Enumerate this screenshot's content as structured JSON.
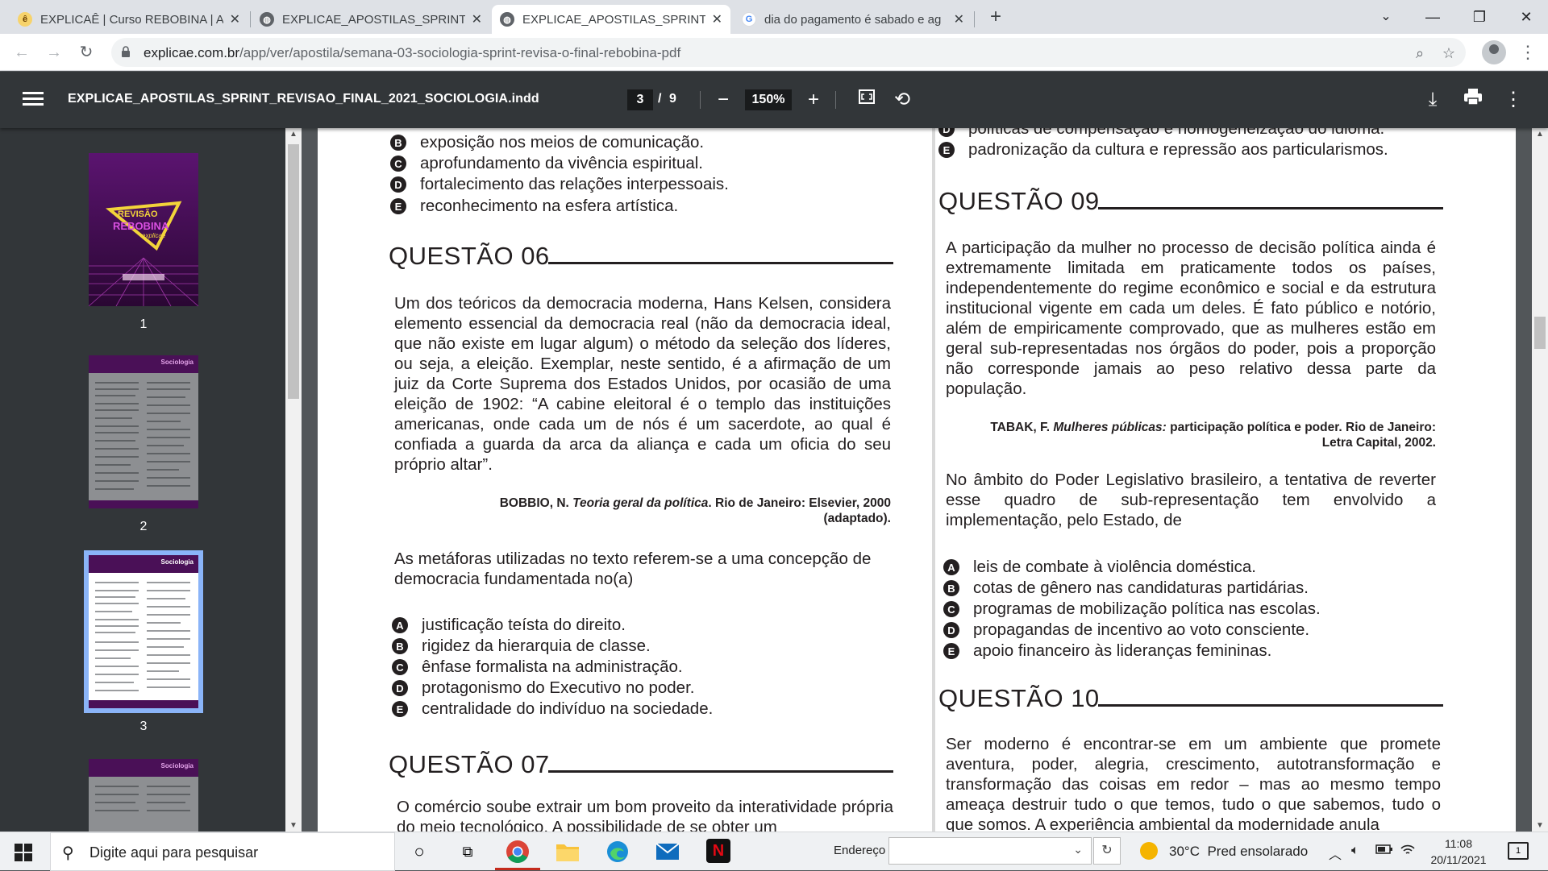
{
  "browser": {
    "tabs": [
      {
        "title": "EXPLICAÊ | Curso REBOBINA | Au",
        "active": false
      },
      {
        "title": "EXPLICAE_APOSTILAS_SPRINT_RE",
        "active": false
      },
      {
        "title": "EXPLICAE_APOSTILAS_SPRINT_RE",
        "active": true
      },
      {
        "title": "dia do pagamento é sabado e ag",
        "active": false
      }
    ],
    "new_tab": "+",
    "url_domain": "explicae.com.br",
    "url_path": "/app/ver/apostila/semana-03-sociologia-sprint-revisa-o-final-rebobina-pdf"
  },
  "pdf": {
    "filename": "EXPLICAE_APOSTILAS_SPRINT_REVISAO_FINAL_2021_SOCIOLOGIA.indd",
    "current_page": "3",
    "page_sep": "/",
    "total_pages": "9",
    "zoom": "150%",
    "thumbnails": [
      {
        "label": "1",
        "cover_line1": "REVISÃO",
        "cover_line2": "REBOBINA",
        "cover_line3": "explicaê"
      },
      {
        "label": "2",
        "header": "Sociologia"
      },
      {
        "label": "3",
        "header": "Sociologia"
      },
      {
        "label": "",
        "header": "Sociologia"
      }
    ]
  },
  "content": {
    "left": {
      "prev_options": [
        {
          "letter": "B",
          "text": "exposição nos meios de comunicação."
        },
        {
          "letter": "C",
          "text": "aprofundamento da vivência espiritual."
        },
        {
          "letter": "D",
          "text": "fortalecimento das relações interpessoais."
        },
        {
          "letter": "E",
          "text": "reconhecimento na esfera artística."
        }
      ],
      "q06_title": "QUESTÃO 06",
      "q06_text": "Um dos teóricos da democracia moderna, Hans Kelsen, considera elemento essencial da democracia real (não da democracia ideal, que não existe em lugar algum) o método da seleção dos líderes, ou seja, a eleição. Exemplar, neste sentido, é a afirmação de um juiz da Corte Suprema dos Estados Unidos, por ocasião de uma eleição de 1902: “A cabine eleitoral é o templo das instituições americanas, onde cada um de nós é um sacerdote, ao qual é confiada a guarda da arca da aliança e cada um oficia do seu próprio altar”.",
      "q06_source_author": "BOBBIO, N. ",
      "q06_source_title": "Teoria geral da política",
      "q06_source_rest": ". Rio de Janeiro: Elsevier, 2000 (adaptado).",
      "q06_prompt": "As metáforas utilizadas no texto referem-se a uma concepção de democracia fundamentada no(a)",
      "q06_options": [
        {
          "letter": "A",
          "text": "justificação teísta do direito."
        },
        {
          "letter": "B",
          "text": "rigidez da hierarquia de classe."
        },
        {
          "letter": "C",
          "text": "ênfase formalista na administração."
        },
        {
          "letter": "D",
          "text": "protagonismo do Executivo no poder."
        },
        {
          "letter": "E",
          "text": "centralidade do indivíduo na sociedade."
        }
      ],
      "q07_title": "QUESTÃO 07",
      "q07_text": "O comércio soube extrair um bom proveito da interatividade própria do meio tecnológico. A possibilidade de se obter um"
    },
    "right": {
      "prev_option_cut": "políticas de compensação e homogeneização do idioma.",
      "prev_option_e": "padronização da cultura e repressão aos particularismos.",
      "q09_title": "QUESTÃO 09",
      "q09_text": "A participação da mulher no processo de decisão política ainda é extremamente limitada em praticamente todos os países, independentemente do regime econômico e social e da estrutura institucional vigente em cada um deles. É fato público e notório, além de empiricamente comprovado, que as mulheres estão em geral sub-representadas nos órgãos do poder, pois a proporção não corresponde jamais ao peso relativo dessa parte da população.",
      "q09_source_author": "TABAK, F. ",
      "q09_source_title": "Mulheres públicas:",
      "q09_source_rest": " participação política e poder. Rio de Janeiro: Letra Capital, 2002.",
      "q09_prompt": "No âmbito do Poder Legislativo brasileiro, a tentativa de reverter esse quadro de sub-representação tem envolvido a implementação, pelo Estado, de",
      "q09_options": [
        {
          "letter": "A",
          "text": "leis de combate à violência doméstica."
        },
        {
          "letter": "B",
          "text": "cotas de gênero nas candidaturas partidárias."
        },
        {
          "letter": "C",
          "text": "programas de mobilização política nas escolas."
        },
        {
          "letter": "D",
          "text": "propagandas de incentivo ao voto consciente."
        },
        {
          "letter": "E",
          "text": "apoio financeiro às lideranças femininas."
        }
      ],
      "q10_title": "QUESTÃO 10",
      "q10_text": "Ser moderno é encontrar-se em um ambiente que promete aventura, poder, alegria, crescimento, autotransformação e transformação das coisas em redor – mas ao mesmo tempo ameaça destruir tudo o que temos, tudo o que sabemos, tudo o que somos. A experiência ambiental da modernidade anula"
    }
  },
  "taskbar": {
    "search_placeholder": "Digite aqui para pesquisar",
    "address_label": "Endereço",
    "weather_temp": "30°C",
    "weather_desc": "Pred ensolarado",
    "time": "11:08",
    "date": "20/11/2021",
    "notifications": "1"
  }
}
